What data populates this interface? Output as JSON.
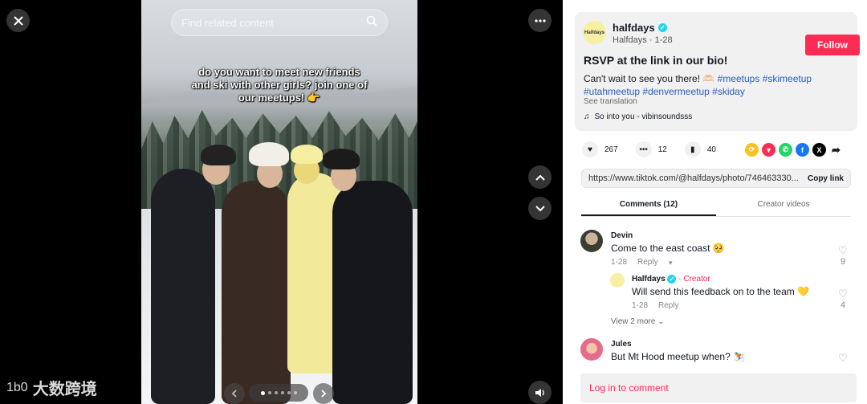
{
  "viewer": {
    "search_placeholder": "Find related content",
    "caption": "do you want to meet new friends and ski with other girls? join one of our meetups! 👉",
    "close_icon": "close-icon",
    "more_icon": "ellipsis-icon",
    "prev_icon": "chevron-up-icon",
    "next_icon": "chevron-down-icon",
    "volume_icon": "volume-icon",
    "watermark": "大数跨境",
    "watermark_logo": "1b0"
  },
  "post": {
    "brand_avatar_text": "Halfdays",
    "username": "halfdays",
    "sub": "Halfdays · 1-28",
    "follow_label": "Follow",
    "title": "RSVP at the link in our bio!",
    "desc_text": "Can't wait to see you there! 🫶🏻 ",
    "hashtags": [
      "#meetups",
      "#skimeetup",
      "#utahmeetup",
      "#denvermeetup",
      "#skiday"
    ],
    "see_translation": "See translation",
    "music": "So into you - vibinsoundsss"
  },
  "actions": {
    "likes": "267",
    "comments": "12",
    "saves": "40",
    "share_colors": [
      "#fcc21b",
      "#fe2c55",
      "#25d366",
      "#1877f2",
      "#000000"
    ]
  },
  "link": {
    "url": "https://www.tiktok.com/@halfdays/photo/746463330...",
    "copy_label": "Copy link"
  },
  "tabs": [
    "Comments (12)",
    "Creator videos"
  ],
  "comments": [
    {
      "name": "Devin",
      "text": "Come to the east coast 🥺",
      "date": "1-28",
      "reply": "Reply",
      "likes": "9"
    },
    {
      "name": "Halfdays",
      "creator": "· Creator",
      "text": "Will send this feedback on to the team 💛",
      "date": "1-28",
      "reply": "Reply",
      "likes": "4"
    },
    {
      "name": "Jules",
      "text": "But Mt Hood meetup when? ⛷️"
    }
  ],
  "view_more": "View 2 more",
  "login_label": "Log in to comment"
}
